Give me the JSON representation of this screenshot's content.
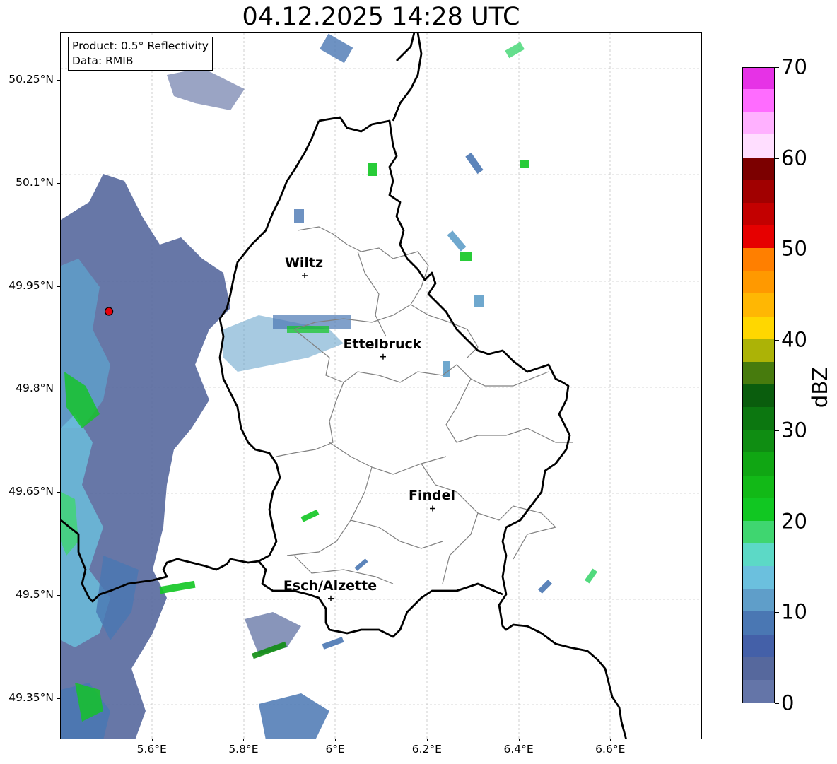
{
  "title": "04.12.2025 14:28 UTC",
  "info": {
    "product": "Product: 0.5° Reflectivity",
    "data": "Data: RMIB"
  },
  "map_extent": {
    "lon_min": 5.4,
    "lon_max": 6.8,
    "lat_min": 49.29,
    "lat_max": 50.32
  },
  "lat_ticks": [
    {
      "value": 50.25,
      "label": "50.25°N"
    },
    {
      "value": 50.1,
      "label": "50.1°N"
    },
    {
      "value": 49.95,
      "label": "49.95°N"
    },
    {
      "value": 49.8,
      "label": "49.8°N"
    },
    {
      "value": 49.65,
      "label": "49.65°N"
    },
    {
      "value": 49.5,
      "label": "49.5°N"
    },
    {
      "value": 49.35,
      "label": "49.35°N"
    }
  ],
  "lon_ticks": [
    {
      "value": 5.6,
      "label": "5.6°E"
    },
    {
      "value": 5.8,
      "label": "5.8°E"
    },
    {
      "value": 6.0,
      "label": "6°E"
    },
    {
      "value": 6.2,
      "label": "6.2°E"
    },
    {
      "value": 6.4,
      "label": "6.4°E"
    },
    {
      "value": 6.6,
      "label": "6.6°E"
    }
  ],
  "cities": [
    {
      "name": "Wiltz",
      "lon": 5.932,
      "lat": 49.966
    },
    {
      "name": "Ettelbruck",
      "lon": 6.103,
      "lat": 49.848
    },
    {
      "name": "Findel",
      "lon": 6.211,
      "lat": 49.627
    },
    {
      "name": "Esch/Alzette",
      "lon": 5.989,
      "lat": 49.496
    }
  ],
  "radar_site": {
    "lon": 5.505,
    "lat": 49.914,
    "color": "#e8000b"
  },
  "colorbar": {
    "label": "dBZ",
    "min": 0,
    "max": 70,
    "ticks": [
      {
        "value": 0,
        "label": "0"
      },
      {
        "value": 10,
        "label": "10"
      },
      {
        "value": 20,
        "label": "20"
      },
      {
        "value": 30,
        "label": "30"
      },
      {
        "value": 40,
        "label": "40"
      },
      {
        "value": 50,
        "label": "50"
      },
      {
        "value": 60,
        "label": "60"
      },
      {
        "value": 70,
        "label": "70"
      }
    ],
    "colors": [
      "#6475a8",
      "#56689d",
      "#4460a8",
      "#4a77b3",
      "#5f9ec9",
      "#6bc0de",
      "#5cd9c6",
      "#3fd670",
      "#11c722",
      "#12b917",
      "#10a613",
      "#0f8d12",
      "#0c7710",
      "#0a5d0d",
      "#477b0d",
      "#acb306",
      "#ffd700",
      "#ffb703",
      "#ff9900",
      "#ff7f00",
      "#e60000",
      "#c30000",
      "#a10000",
      "#7c0000",
      "#ffdeff",
      "#ffb1ff",
      "#ff6cff",
      "#e632e6"
    ]
  }
}
